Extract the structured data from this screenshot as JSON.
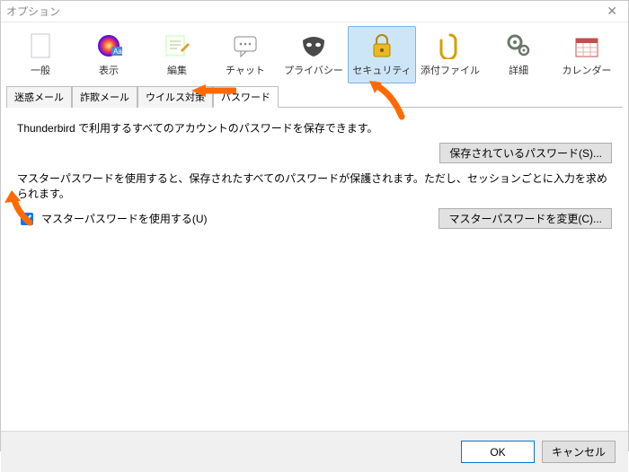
{
  "window": {
    "title": "オプション"
  },
  "toolbar": {
    "items": [
      {
        "label": "一般"
      },
      {
        "label": "表示"
      },
      {
        "label": "編集"
      },
      {
        "label": "チャット"
      },
      {
        "label": "プライバシー"
      },
      {
        "label": "セキュリティ"
      },
      {
        "label": "添付ファイル"
      },
      {
        "label": "詳細"
      },
      {
        "label": "カレンダー"
      }
    ]
  },
  "tabs": {
    "items": [
      {
        "label": "迷惑メール"
      },
      {
        "label": "詐欺メール"
      },
      {
        "label": "ウイルス対策"
      },
      {
        "label": "パスワード"
      }
    ]
  },
  "content": {
    "desc1": "Thunderbird で利用するすべてのアカウントのパスワードを保存できます。",
    "btnSaved": "保存されているパスワード(S)...",
    "desc2": "マスターパスワードを使用すると、保存されたすべてのパスワードが保護されます。ただし、セッションごとに入力を求められます。",
    "cbLabel": "マスターパスワードを使用する(U)",
    "btnChange": "マスターパスワードを変更(C)..."
  },
  "footer": {
    "ok": "OK",
    "cancel": "キャンセル"
  },
  "colors": {
    "arrow": "#ff6a00"
  }
}
